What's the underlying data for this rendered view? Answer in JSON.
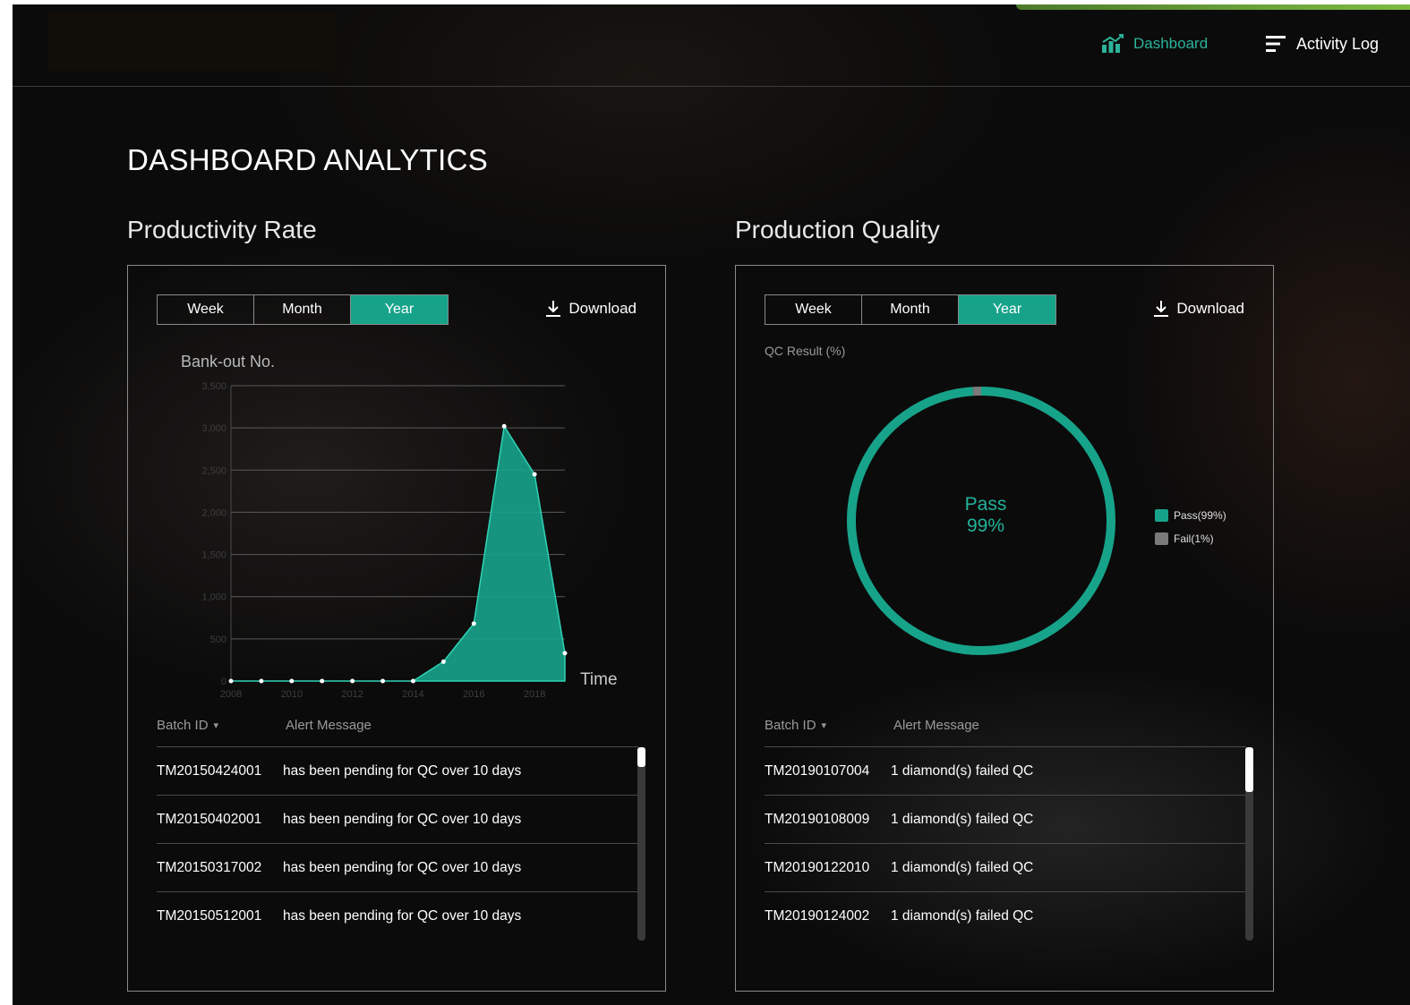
{
  "nav": {
    "dashboard_label": "Dashboard",
    "activity_label": "Activity Log",
    "dashboard_icon": "bar-chart-icon",
    "activity_icon": "menu-lines-icon",
    "accent_color": "#2bb39b"
  },
  "page": {
    "title": "DASHBOARD ANALYTICS"
  },
  "productivity": {
    "title": "Productivity Rate",
    "tabs": [
      "Week",
      "Month",
      "Year"
    ],
    "active_tab": "Year",
    "download_label": "Download",
    "y_label": "Bank-out No.",
    "x_label": "Time",
    "table": {
      "col_batch": "Batch ID",
      "col_alert": "Alert Message",
      "rows": [
        {
          "batch": "TM20150424001",
          "message": "has been pending for QC over 10 days"
        },
        {
          "batch": "TM20150402001",
          "message": "has been pending for QC over 10 days"
        },
        {
          "batch": "TM20150317002",
          "message": "has been pending for QC over 10 days"
        },
        {
          "batch": "TM20150512001",
          "message": "has been pending for QC over 10 days"
        }
      ]
    }
  },
  "quality": {
    "title": "Production Quality",
    "tabs": [
      "Week",
      "Month",
      "Year"
    ],
    "active_tab": "Year",
    "download_label": "Download",
    "qc_label": "QC Result (%)",
    "center_label": "Pass",
    "center_value": "99%",
    "legend": [
      {
        "label": "Pass(99%)",
        "color": "#17a38a"
      },
      {
        "label": "Fail(1%)",
        "color": "#7a7a7a"
      }
    ],
    "table": {
      "col_batch": "Batch ID",
      "col_alert": "Alert Message",
      "rows": [
        {
          "batch": "TM20190107004",
          "message": "1 diamond(s) failed QC"
        },
        {
          "batch": "TM20190108009",
          "message": "1 diamond(s) failed QC"
        },
        {
          "batch": "TM20190122010",
          "message": "1 diamond(s) failed QC"
        },
        {
          "batch": "TM20190124002",
          "message": "1 diamond(s) failed QC"
        }
      ]
    }
  },
  "chart_data": [
    {
      "type": "area",
      "title": "",
      "ylabel": "Bank-out No.",
      "xlabel": "Time",
      "ylim": [
        0,
        3500
      ],
      "y_ticks": [
        "0",
        "500",
        "1,000",
        "1,500",
        "2,000",
        "2,500",
        "3,000",
        "3,500"
      ],
      "x_ticks": [
        "2008",
        "2010",
        "2012",
        "2014",
        "2016",
        "2018"
      ],
      "x": [
        2008,
        2009,
        2010,
        2011,
        2012,
        2013,
        2014,
        2015,
        2016,
        2017,
        2018,
        2019
      ],
      "values": [
        0,
        0,
        0,
        0,
        0,
        0,
        0,
        230,
        680,
        3020,
        2450,
        330
      ],
      "color": "#17a38a",
      "grid": true
    },
    {
      "type": "pie",
      "title": "QC Result (%)",
      "series": [
        {
          "name": "Pass",
          "values": [
            99
          ]
        },
        {
          "name": "Fail",
          "values": [
            1
          ]
        }
      ],
      "categories": [
        "Pass",
        "Fail"
      ],
      "values": [
        99,
        1
      ],
      "colors": [
        "#17a38a",
        "#7a7a7a"
      ],
      "legend": "right"
    }
  ]
}
